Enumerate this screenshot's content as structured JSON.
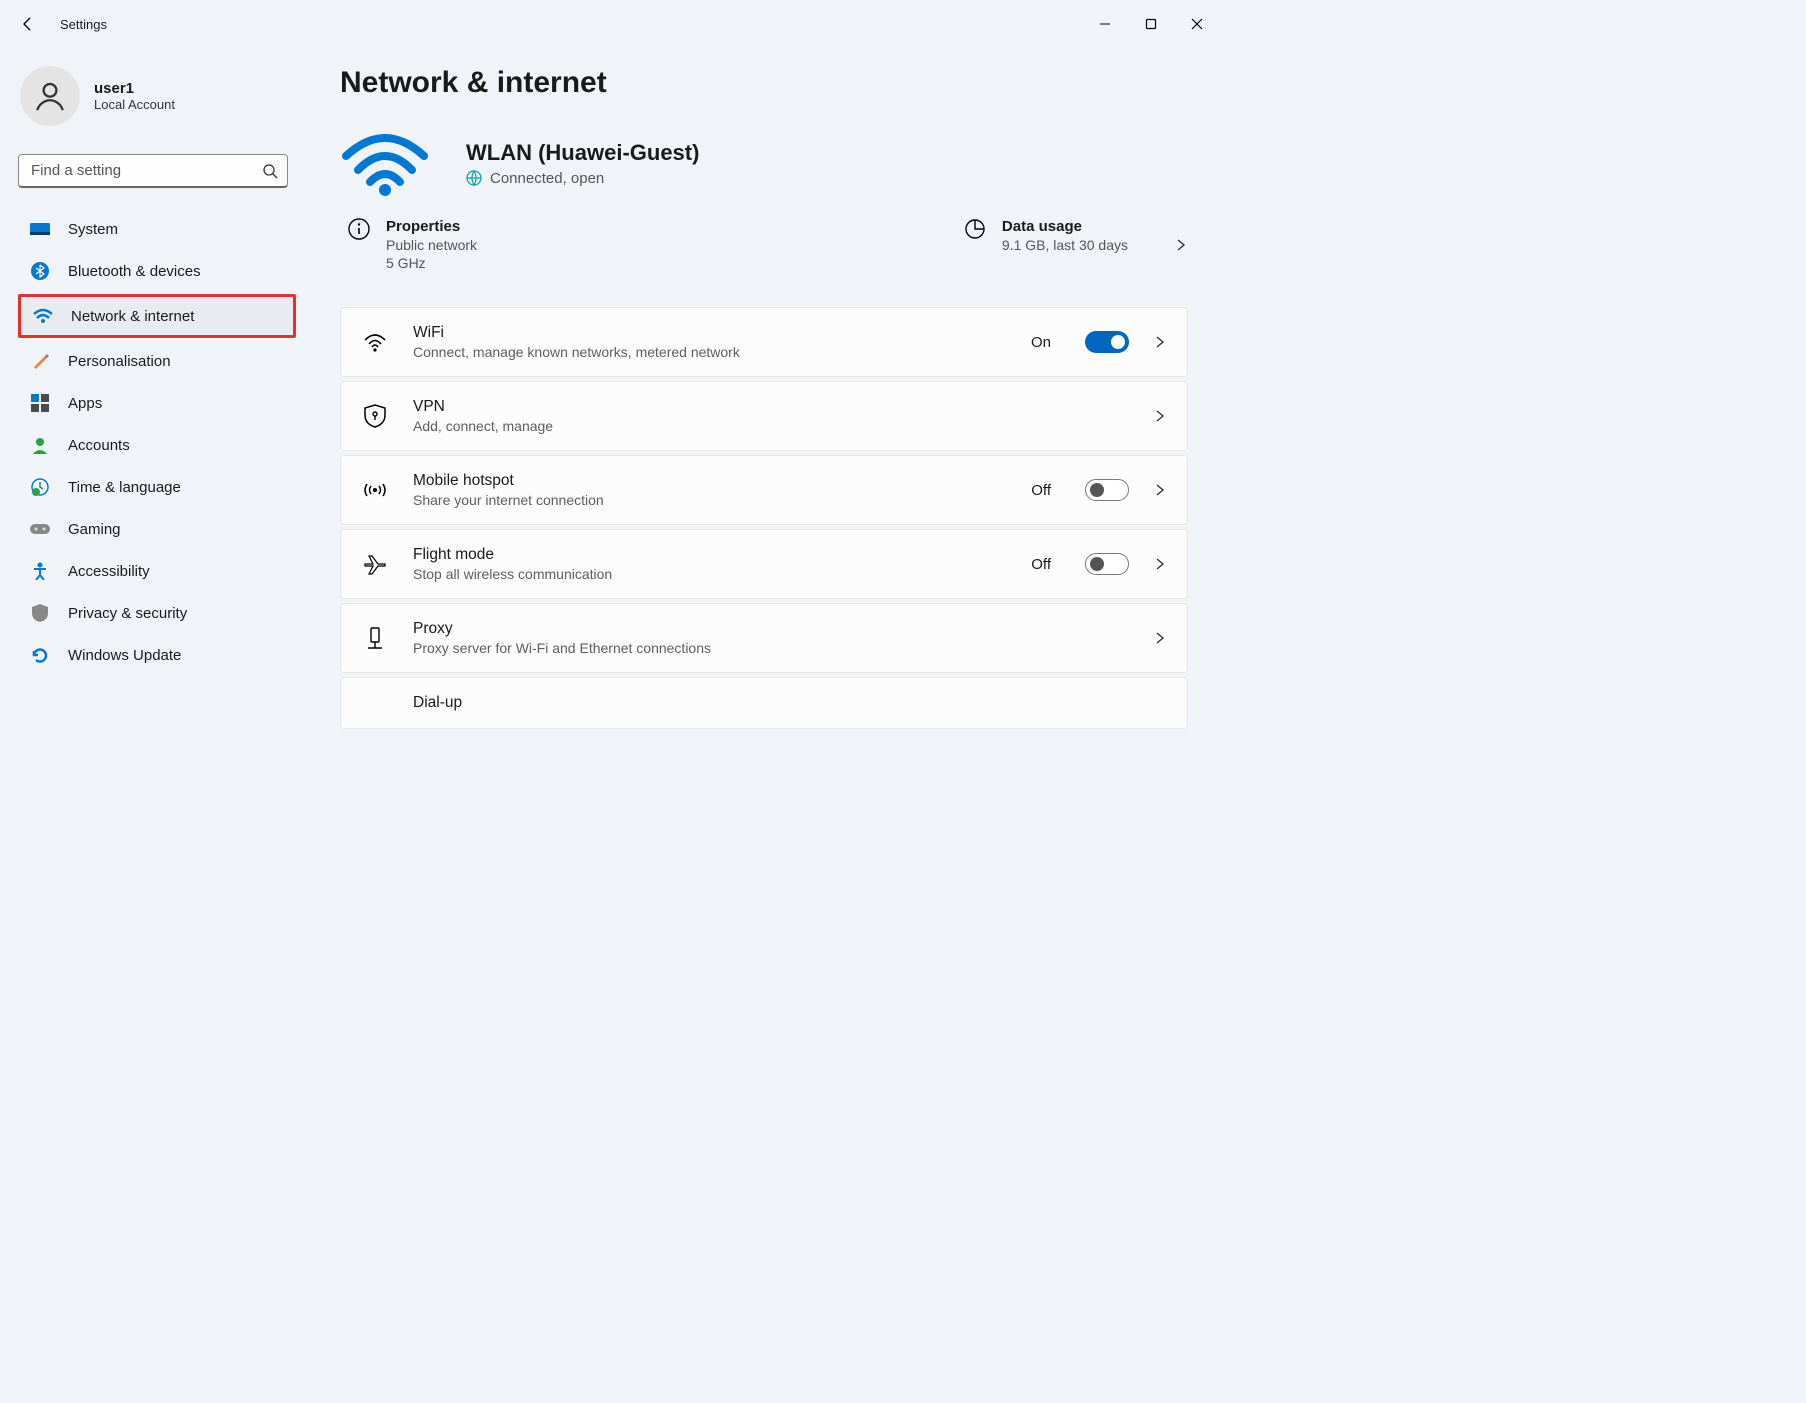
{
  "appTitle": "Settings",
  "user": {
    "name": "user1",
    "sub": "Local Account"
  },
  "search": {
    "placeholder": "Find a setting"
  },
  "sidebar": {
    "items": [
      {
        "id": "system",
        "label": "System"
      },
      {
        "id": "bluetooth",
        "label": "Bluetooth & devices"
      },
      {
        "id": "network",
        "label": "Network & internet"
      },
      {
        "id": "personalisation",
        "label": "Personalisation"
      },
      {
        "id": "apps",
        "label": "Apps"
      },
      {
        "id": "accounts",
        "label": "Accounts"
      },
      {
        "id": "time",
        "label": "Time & language"
      },
      {
        "id": "gaming",
        "label": "Gaming"
      },
      {
        "id": "accessibility",
        "label": "Accessibility"
      },
      {
        "id": "privacy",
        "label": "Privacy & security"
      },
      {
        "id": "update",
        "label": "Windows Update"
      }
    ],
    "activeId": "network"
  },
  "page": {
    "title": "Network & internet",
    "status": {
      "name": "WLAN (Huawei-Guest)",
      "connection": "Connected, open"
    },
    "properties": {
      "title": "Properties",
      "line1": "Public network",
      "line2": "5 GHz"
    },
    "dataUsage": {
      "title": "Data usage",
      "line1": "9.1 GB, last 30 days"
    },
    "cards": [
      {
        "id": "wifi",
        "title": "WiFi",
        "sub": "Connect, manage known networks, metered network",
        "toggle": "On"
      },
      {
        "id": "vpn",
        "title": "VPN",
        "sub": "Add, connect, manage",
        "toggle": null
      },
      {
        "id": "hotspot",
        "title": "Mobile hotspot",
        "sub": "Share your internet connection",
        "toggle": "Off"
      },
      {
        "id": "flight",
        "title": "Flight mode",
        "sub": "Stop all wireless communication",
        "toggle": "Off"
      },
      {
        "id": "proxy",
        "title": "Proxy",
        "sub": "Proxy server for Wi-Fi and Ethernet connections",
        "toggle": null
      },
      {
        "id": "dialup",
        "title": "Dial-up",
        "sub": "",
        "toggle": null
      }
    ]
  }
}
